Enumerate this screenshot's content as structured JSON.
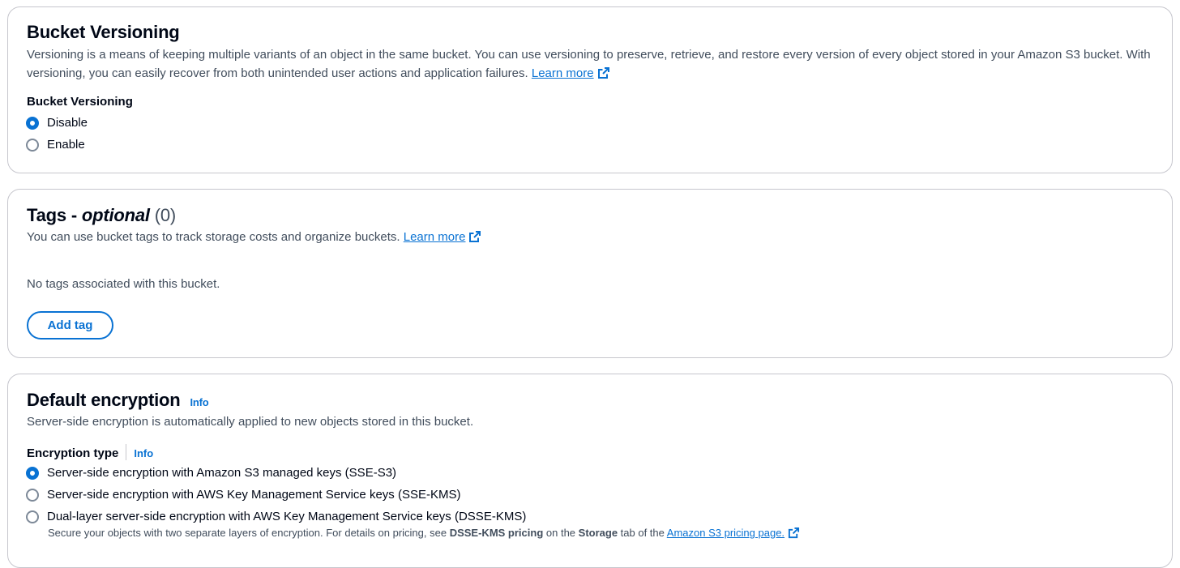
{
  "versioning": {
    "title": "Bucket Versioning",
    "description": "Versioning is a means of keeping multiple variants of an object in the same bucket. You can use versioning to preserve, retrieve, and restore every version of every object stored in your Amazon S3 bucket. With versioning, you can easily recover from both unintended user actions and application failures.",
    "learn_more": "Learn more",
    "field_label": "Bucket Versioning",
    "options": [
      {
        "label": "Disable",
        "selected": true
      },
      {
        "label": "Enable",
        "selected": false
      }
    ]
  },
  "tags": {
    "title_prefix": "Tags - ",
    "title_italic": "optional",
    "count": "(0)",
    "description": "You can use bucket tags to track storage costs and organize buckets.",
    "learn_more": "Learn more",
    "empty_text": "No tags associated with this bucket.",
    "add_button": "Add tag"
  },
  "encryption": {
    "title": "Default encryption",
    "info": "Info",
    "description": "Server-side encryption is automatically applied to new objects stored in this bucket.",
    "type_label": "Encryption type",
    "type_info": "Info",
    "options": [
      {
        "label": "Server-side encryption with Amazon S3 managed keys (SSE-S3)",
        "selected": true
      },
      {
        "label": "Server-side encryption with AWS Key Management Service keys (SSE-KMS)",
        "selected": false
      },
      {
        "label": "Dual-layer server-side encryption with AWS Key Management Service keys (DSSE-KMS)",
        "selected": false
      }
    ],
    "dsse_note": {
      "part1": "Secure your objects with two separate layers of encryption. For details on pricing, see ",
      "bold1": "DSSE-KMS pricing",
      "part2": " on the ",
      "bold2": "Storage",
      "part3": " tab of the ",
      "link": "Amazon S3 pricing page."
    }
  },
  "icons": {
    "external_link": "external-link-icon",
    "radio_checked": "radio-checked-icon",
    "radio_unchecked": "radio-unchecked-icon"
  },
  "colors": {
    "accent": "#0972d3",
    "text": "#000716",
    "muted": "#414d5c",
    "border": "#c6c6cd"
  }
}
